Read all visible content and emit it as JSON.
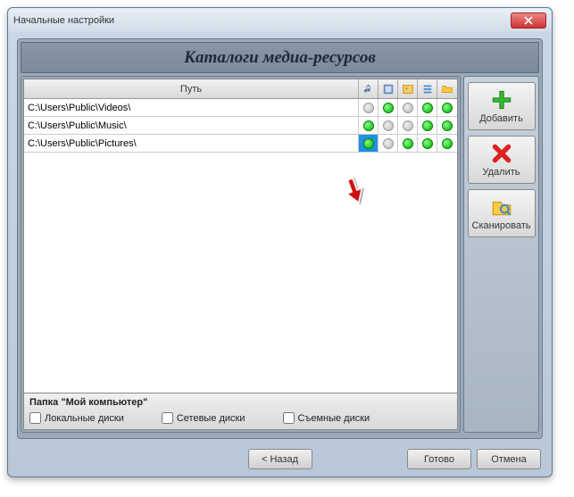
{
  "window": {
    "title": "Начальные настройки"
  },
  "header": {
    "title": "Каталоги медиа-ресурсов"
  },
  "table": {
    "path_header": "Путь",
    "rows": [
      {
        "path": "C:\\Users\\Public\\Videos\\",
        "dots": [
          "grey",
          "green",
          "grey",
          "green",
          "green"
        ]
      },
      {
        "path": "C:\\Users\\Public\\Music\\",
        "dots": [
          "green",
          "grey",
          "grey",
          "green",
          "green"
        ]
      },
      {
        "path": "C:\\Users\\Public\\Pictures\\",
        "dots": [
          "green",
          "grey",
          "green",
          "green",
          "green"
        ],
        "highlight": 0
      }
    ]
  },
  "footer": {
    "title": "Папка \"Мой компьютер\"",
    "checks": {
      "local": "Локальные диски",
      "network": "Сетевые диски",
      "removable": "Съемные диски"
    }
  },
  "side": {
    "add": "Добавить",
    "remove": "Удалить",
    "scan": "Сканировать"
  },
  "wizard": {
    "back": "< Назад",
    "finish": "Готово",
    "cancel": "Отмена"
  }
}
